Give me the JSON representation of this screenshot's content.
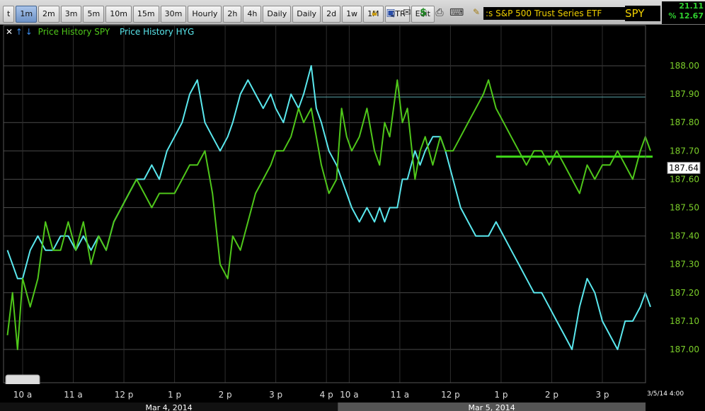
{
  "toolbar": {
    "tabs": [
      "t",
      "1m",
      "2m",
      "3m",
      "5m",
      "10m",
      "15m",
      "30m",
      "Hourly",
      "2h",
      "4h",
      "Daily",
      "Daily",
      "2d",
      "1w",
      "1M",
      "QTR",
      "Edit"
    ],
    "active_tab": 1,
    "icons": [
      "lock-icon",
      "save-icon",
      "mail-icon",
      "dollar-icon",
      "print-icon",
      "keyboard-icon",
      "pencil-icon"
    ],
    "title": ":s S&P 500 Trust Series ETF",
    "ticker": "SPY",
    "quote_line1": "21.11",
    "quote_line2": "% 12.67"
  },
  "legend": {
    "close": "✕",
    "up": "↑",
    "down": "↓",
    "spy_label": "Price History SPY",
    "hyg_label": "Price History HYG"
  },
  "colors": {
    "spy": "#4fc71a",
    "hyg": "#5ae8ee",
    "axis_text": "#7ccf2a",
    "grid": "#4a4a4a",
    "ref_line": "#5aa6ad",
    "price_line": "#3fd619"
  },
  "chart_data": {
    "type": "line",
    "title": "",
    "ylabel": "",
    "ylim": [
      186.95,
      188.05
    ],
    "y_ticks": [
      "188.00",
      "187.90",
      "187.80",
      "187.70",
      "187.60",
      "187.50",
      "187.40",
      "187.30",
      "187.20",
      "187.10",
      "187.00"
    ],
    "y_tick_values": [
      188.0,
      187.9,
      187.8,
      187.7,
      187.6,
      187.5,
      187.4,
      187.3,
      187.2,
      187.1,
      187.0
    ],
    "sessions": [
      {
        "date": "Mar 4, 2014",
        "from": 0,
        "to": 6
      },
      {
        "date": "Mar 5, 2014",
        "from": 6,
        "to": 12.5
      }
    ],
    "x_ticks": [
      {
        "t": 0,
        "label": "10 a"
      },
      {
        "t": 1,
        "label": "11 a"
      },
      {
        "t": 2,
        "label": "12 p"
      },
      {
        "t": 3,
        "label": "1 p"
      },
      {
        "t": 4,
        "label": "2 p"
      },
      {
        "t": 5,
        "label": "3 p"
      },
      {
        "t": 6,
        "label": "4 p"
      },
      {
        "t": 6.45,
        "label": "10 a"
      },
      {
        "t": 7.45,
        "label": "11 a"
      },
      {
        "t": 8.45,
        "label": "12 p"
      },
      {
        "t": 9.45,
        "label": "1 p"
      },
      {
        "t": 10.45,
        "label": "2 p"
      },
      {
        "t": 11.45,
        "label": "3 p"
      }
    ],
    "end_label": "3/5/14 4:00",
    "last_price": "187.64",
    "last_price_value": 187.64,
    "price_line_value": 187.68,
    "price_line_from": 9.35,
    "ref_line_value": 187.89,
    "ref_line_from": 5.6,
    "series": [
      {
        "name": "Price History SPY",
        "color": "#4fc71a",
        "points": [
          [
            -0.3,
            187.05
          ],
          [
            -0.2,
            187.2
          ],
          [
            -0.1,
            187.0
          ],
          [
            0.0,
            187.25
          ],
          [
            0.15,
            187.15
          ],
          [
            0.3,
            187.25
          ],
          [
            0.45,
            187.45
          ],
          [
            0.6,
            187.35
          ],
          [
            0.75,
            187.35
          ],
          [
            0.9,
            187.45
          ],
          [
            1.05,
            187.35
          ],
          [
            1.2,
            187.45
          ],
          [
            1.35,
            187.3
          ],
          [
            1.5,
            187.4
          ],
          [
            1.65,
            187.35
          ],
          [
            1.8,
            187.45
          ],
          [
            1.95,
            187.5
          ],
          [
            2.1,
            187.55
          ],
          [
            2.25,
            187.6
          ],
          [
            2.4,
            187.55
          ],
          [
            2.55,
            187.5
          ],
          [
            2.7,
            187.55
          ],
          [
            2.85,
            187.55
          ],
          [
            3.0,
            187.55
          ],
          [
            3.15,
            187.6
          ],
          [
            3.3,
            187.65
          ],
          [
            3.45,
            187.65
          ],
          [
            3.6,
            187.7
          ],
          [
            3.75,
            187.55
          ],
          [
            3.9,
            187.3
          ],
          [
            4.05,
            187.25
          ],
          [
            4.15,
            187.4
          ],
          [
            4.3,
            187.35
          ],
          [
            4.45,
            187.45
          ],
          [
            4.6,
            187.55
          ],
          [
            4.75,
            187.6
          ],
          [
            4.9,
            187.65
          ],
          [
            5.0,
            187.7
          ],
          [
            5.15,
            187.7
          ],
          [
            5.3,
            187.75
          ],
          [
            5.45,
            187.85
          ],
          [
            5.55,
            187.8
          ],
          [
            5.7,
            187.85
          ],
          [
            5.8,
            187.75
          ],
          [
            5.9,
            187.65
          ],
          [
            6.05,
            187.55
          ],
          [
            6.2,
            187.6
          ],
          [
            6.3,
            187.85
          ],
          [
            6.4,
            187.75
          ],
          [
            6.5,
            187.7
          ],
          [
            6.65,
            187.75
          ],
          [
            6.8,
            187.85
          ],
          [
            6.95,
            187.7
          ],
          [
            7.05,
            187.65
          ],
          [
            7.15,
            187.8
          ],
          [
            7.25,
            187.75
          ],
          [
            7.4,
            187.95
          ],
          [
            7.5,
            187.8
          ],
          [
            7.6,
            187.85
          ],
          [
            7.75,
            187.6
          ],
          [
            7.85,
            187.7
          ],
          [
            7.95,
            187.75
          ],
          [
            8.1,
            187.65
          ],
          [
            8.25,
            187.75
          ],
          [
            8.35,
            187.7
          ],
          [
            8.5,
            187.7
          ],
          [
            8.65,
            187.75
          ],
          [
            8.8,
            187.8
          ],
          [
            8.95,
            187.85
          ],
          [
            9.1,
            187.9
          ],
          [
            9.2,
            187.95
          ],
          [
            9.35,
            187.85
          ],
          [
            9.5,
            187.8
          ],
          [
            9.65,
            187.75
          ],
          [
            9.8,
            187.7
          ],
          [
            9.95,
            187.65
          ],
          [
            10.1,
            187.7
          ],
          [
            10.25,
            187.7
          ],
          [
            10.4,
            187.65
          ],
          [
            10.55,
            187.7
          ],
          [
            10.7,
            187.65
          ],
          [
            10.85,
            187.6
          ],
          [
            11.0,
            187.55
          ],
          [
            11.15,
            187.65
          ],
          [
            11.3,
            187.6
          ],
          [
            11.45,
            187.65
          ],
          [
            11.6,
            187.65
          ],
          [
            11.75,
            187.7
          ],
          [
            11.9,
            187.65
          ],
          [
            12.05,
            187.6
          ],
          [
            12.2,
            187.7
          ],
          [
            12.3,
            187.75
          ],
          [
            12.4,
            187.7
          ]
        ]
      },
      {
        "name": "Price History HYG",
        "color": "#5ae8ee",
        "points": [
          [
            -0.3,
            187.35
          ],
          [
            -0.2,
            187.3
          ],
          [
            -0.1,
            187.25
          ],
          [
            0.0,
            187.25
          ],
          [
            0.15,
            187.35
          ],
          [
            0.3,
            187.4
          ],
          [
            0.45,
            187.35
          ],
          [
            0.6,
            187.35
          ],
          [
            0.75,
            187.4
          ],
          [
            0.9,
            187.4
          ],
          [
            1.05,
            187.35
          ],
          [
            1.2,
            187.4
          ],
          [
            1.35,
            187.35
          ],
          [
            1.5,
            187.4
          ],
          [
            1.65,
            187.35
          ],
          [
            1.8,
            187.45
          ],
          [
            1.95,
            187.5
          ],
          [
            2.1,
            187.55
          ],
          [
            2.25,
            187.6
          ],
          [
            2.4,
            187.6
          ],
          [
            2.55,
            187.65
          ],
          [
            2.7,
            187.6
          ],
          [
            2.85,
            187.7
          ],
          [
            3.0,
            187.75
          ],
          [
            3.15,
            187.8
          ],
          [
            3.3,
            187.9
          ],
          [
            3.45,
            187.95
          ],
          [
            3.6,
            187.8
          ],
          [
            3.75,
            187.75
          ],
          [
            3.9,
            187.7
          ],
          [
            4.05,
            187.75
          ],
          [
            4.15,
            187.8
          ],
          [
            4.3,
            187.9
          ],
          [
            4.45,
            187.95
          ],
          [
            4.6,
            187.9
          ],
          [
            4.75,
            187.85
          ],
          [
            4.9,
            187.9
          ],
          [
            5.0,
            187.85
          ],
          [
            5.15,
            187.8
          ],
          [
            5.3,
            187.9
          ],
          [
            5.45,
            187.85
          ],
          [
            5.55,
            187.9
          ],
          [
            5.7,
            188.0
          ],
          [
            5.8,
            187.85
          ],
          [
            5.9,
            187.8
          ],
          [
            6.05,
            187.7
          ],
          [
            6.2,
            187.65
          ],
          [
            6.3,
            187.6
          ],
          [
            6.4,
            187.55
          ],
          [
            6.5,
            187.5
          ],
          [
            6.65,
            187.45
          ],
          [
            6.8,
            187.5
          ],
          [
            6.95,
            187.45
          ],
          [
            7.05,
            187.5
          ],
          [
            7.15,
            187.45
          ],
          [
            7.25,
            187.5
          ],
          [
            7.4,
            187.5
          ],
          [
            7.5,
            187.6
          ],
          [
            7.6,
            187.6
          ],
          [
            7.75,
            187.7
          ],
          [
            7.85,
            187.65
          ],
          [
            7.95,
            187.7
          ],
          [
            8.1,
            187.75
          ],
          [
            8.25,
            187.75
          ],
          [
            8.35,
            187.7
          ],
          [
            8.5,
            187.6
          ],
          [
            8.65,
            187.5
          ],
          [
            8.8,
            187.45
          ],
          [
            8.95,
            187.4
          ],
          [
            9.1,
            187.4
          ],
          [
            9.2,
            187.4
          ],
          [
            9.35,
            187.45
          ],
          [
            9.5,
            187.4
          ],
          [
            9.65,
            187.35
          ],
          [
            9.8,
            187.3
          ],
          [
            9.95,
            187.25
          ],
          [
            10.1,
            187.2
          ],
          [
            10.25,
            187.2
          ],
          [
            10.4,
            187.15
          ],
          [
            10.55,
            187.1
          ],
          [
            10.7,
            187.05
          ],
          [
            10.85,
            187.0
          ],
          [
            11.0,
            187.15
          ],
          [
            11.15,
            187.25
          ],
          [
            11.3,
            187.2
          ],
          [
            11.45,
            187.1
          ],
          [
            11.6,
            187.05
          ],
          [
            11.75,
            187.0
          ],
          [
            11.9,
            187.1
          ],
          [
            12.05,
            187.1
          ],
          [
            12.2,
            187.15
          ],
          [
            12.3,
            187.2
          ],
          [
            12.4,
            187.15
          ]
        ]
      }
    ]
  }
}
